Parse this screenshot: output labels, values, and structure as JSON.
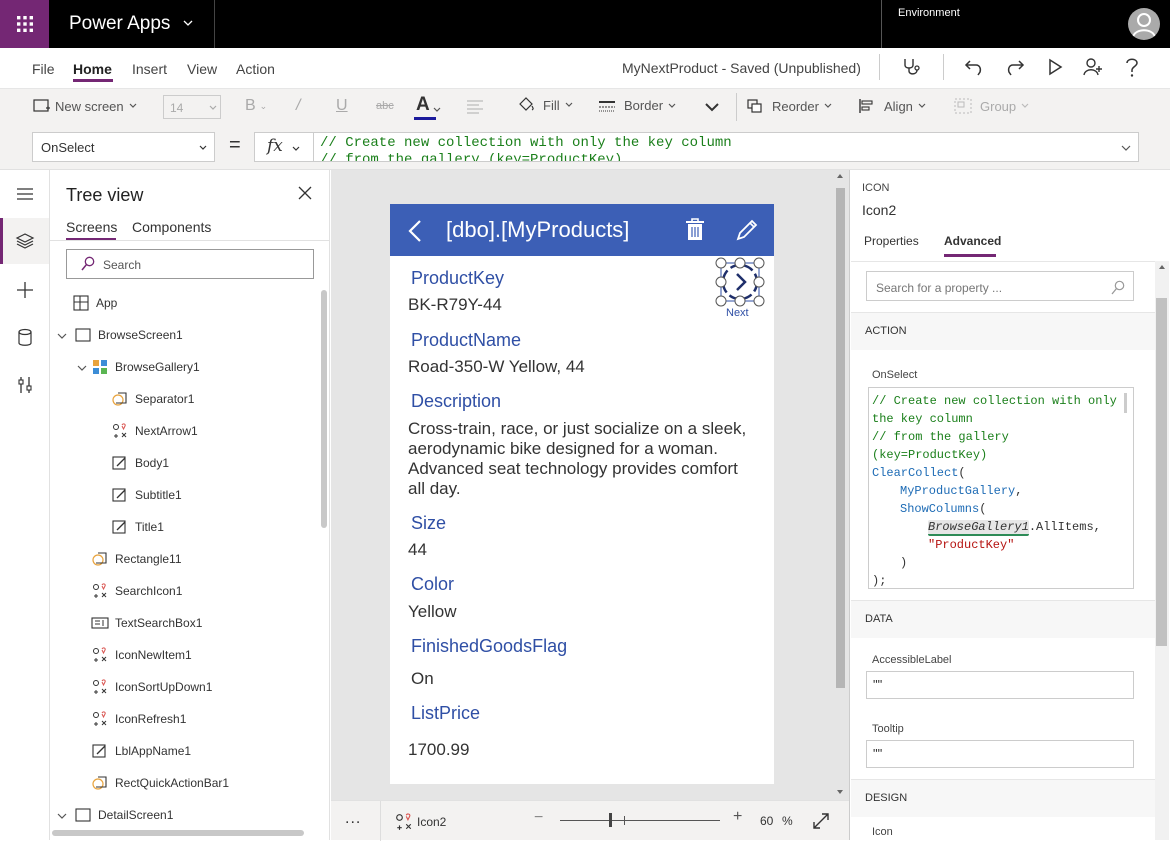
{
  "topbar": {
    "app_name": "Power Apps",
    "environment_label": "Environment"
  },
  "menu": {
    "file": "File",
    "home": "Home",
    "insert": "Insert",
    "view": "View",
    "action": "Action",
    "doc_title": "MyNextProduct - Saved (Unpublished)"
  },
  "ribbon": {
    "new_screen": "New screen",
    "font_size": "14",
    "fill": "Fill",
    "border": "Border",
    "reorder": "Reorder",
    "align": "Align",
    "group": "Group"
  },
  "formula_bar": {
    "property": "OnSelect",
    "equals": "=",
    "fx": "fx",
    "formula_line1": "// Create new collection with only the key column",
    "formula_line2": "// from the gallery (key=ProductKey)"
  },
  "tree": {
    "title": "Tree view",
    "tab_screens": "Screens",
    "tab_components": "Components",
    "search_placeholder": "Search",
    "nodes": [
      {
        "label": "App"
      },
      {
        "label": "BrowseScreen1"
      },
      {
        "label": "BrowseGallery1"
      },
      {
        "label": "Separator1"
      },
      {
        "label": "NextArrow1"
      },
      {
        "label": "Body1"
      },
      {
        "label": "Subtitle1"
      },
      {
        "label": "Title1"
      },
      {
        "label": "Rectangle11"
      },
      {
        "label": "SearchIcon1"
      },
      {
        "label": "TextSearchBox1"
      },
      {
        "label": "IconNewItem1"
      },
      {
        "label": "IconSortUpDown1"
      },
      {
        "label": "IconRefresh1"
      },
      {
        "label": "LblAppName1"
      },
      {
        "label": "RectQuickActionBar1"
      },
      {
        "label": "DetailScreen1"
      }
    ]
  },
  "phone": {
    "title": "[dbo].[MyProducts]",
    "next_label": "Next",
    "fields": [
      {
        "label": "ProductKey",
        "value": "BK-R79Y-44"
      },
      {
        "label": "ProductName",
        "value": "Road-350-W Yellow, 44"
      },
      {
        "label": "Description",
        "value": "Cross-train, race, or just socialize on a sleek, aerodynamic bike designed for a woman. Advanced seat technology provides comfort all day."
      },
      {
        "label": "Size",
        "value": "44"
      },
      {
        "label": "Color",
        "value": "Yellow"
      },
      {
        "label": "FinishedGoodsFlag",
        "value": "On"
      },
      {
        "label": "ListPrice",
        "value": "1700.99"
      }
    ]
  },
  "bottombar": {
    "more": "...",
    "selected_control": "Icon2",
    "zoom_minus": "−",
    "zoom_plus": "+",
    "zoom_value": "60",
    "zoom_unit": "%",
    "zoom_level": 60
  },
  "rpanel": {
    "kind": "ICON",
    "name": "Icon2",
    "tab_properties": "Properties",
    "tab_advanced": "Advanced",
    "search_placeholder": "Search for a property ...",
    "section_action": "ACTION",
    "onselect_label": "OnSelect",
    "code": {
      "l1": "// Create new collection with only",
      "l2": "the key column",
      "l3": "// from the gallery",
      "l4": "(key=ProductKey)",
      "l5_fn": "ClearCollect",
      "l5_p": "(",
      "l6": "MyProductGallery",
      "l6_p": ",",
      "l7_fn": "ShowColumns",
      "l7_p": "(",
      "l8_ref": "BrowseGallery1",
      "l8_rest": ".AllItems,",
      "l9_str": "\"ProductKey\"",
      "l10": ")",
      "l11": ");"
    },
    "section_data": "DATA",
    "accessible_label": "AccessibleLabel",
    "accessible_value": "\"\"",
    "tooltip_label": "Tooltip",
    "tooltip_value": "\"\"",
    "section_design": "DESIGN",
    "icon_label": "Icon"
  },
  "colors": {
    "brand": "#742774",
    "header_blue": "#3c5fb6",
    "field_label": "#2f4fa5"
  }
}
